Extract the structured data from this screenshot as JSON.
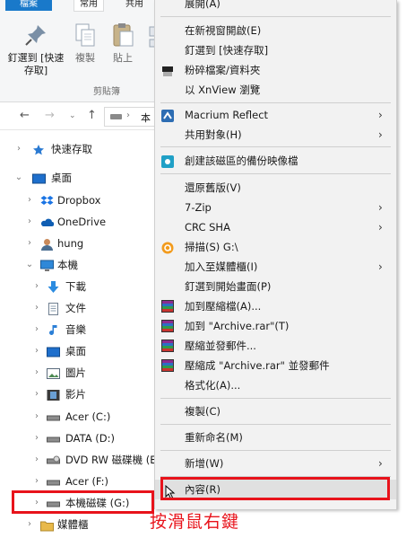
{
  "ribbon": {
    "tabs": [
      "檔案",
      "常用",
      "共用"
    ],
    "pin_label": "釘選到 [快速存取]",
    "copy_label": "複製",
    "paste_label": "貼上",
    "group_label": "剪貼簿"
  },
  "address": {
    "path_fragment": "本"
  },
  "tree": [
    {
      "label": "快速存取"
    },
    {
      "label": "桌面"
    },
    {
      "label": "Dropbox"
    },
    {
      "label": "OneDrive"
    },
    {
      "label": "hung"
    },
    {
      "label": "本機"
    },
    {
      "label": "下載"
    },
    {
      "label": "文件"
    },
    {
      "label": "音樂"
    },
    {
      "label": "桌面"
    },
    {
      "label": "圖片"
    },
    {
      "label": "影片"
    },
    {
      "label": "Acer (C:)"
    },
    {
      "label": "DATA (D:)"
    },
    {
      "label": "DVD RW 磁碟機 (E"
    },
    {
      "label": "Acer (F:)"
    },
    {
      "label": "本機磁碟 (G:)"
    },
    {
      "label": "媒體櫃"
    }
  ],
  "menu": [
    {
      "label": "展開(A)"
    },
    {
      "label": "在新視窗開啟(E)"
    },
    {
      "label": "釘選到 [快速存取]"
    },
    {
      "label": "粉碎檔案/資料夾"
    },
    {
      "label": "以 XnView 瀏覽"
    },
    {
      "label": "Macrium Reflect"
    },
    {
      "label": "共用對象(H)"
    },
    {
      "label": "創建該磁區的備份映像檔"
    },
    {
      "label": "還原舊版(V)"
    },
    {
      "label": "7-Zip"
    },
    {
      "label": "CRC SHA"
    },
    {
      "label": "掃描(S) G:\\"
    },
    {
      "label": "加入至媒體櫃(I)"
    },
    {
      "label": "釘選到開始畫面(P)"
    },
    {
      "label": "加到壓縮檔(A)..."
    },
    {
      "label": "加到 \"Archive.rar\"(T)"
    },
    {
      "label": "壓縮並發郵件..."
    },
    {
      "label": "壓縮成 \"Archive.rar\" 並發郵件"
    },
    {
      "label": "格式化(A)..."
    },
    {
      "label": "複製(C)"
    },
    {
      "label": "重新命名(M)"
    },
    {
      "label": "新增(W)"
    },
    {
      "label": "內容(R)"
    }
  ],
  "caption": "按滑鼠右鍵",
  "colors": {
    "accent": "#1979ca",
    "annotation": "#e8131b",
    "menu_bg": "#f2f2f2"
  }
}
